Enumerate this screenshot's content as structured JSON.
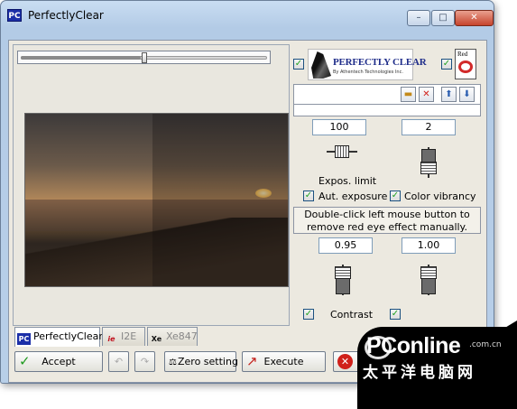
{
  "window": {
    "title": "PerfectlyClear",
    "icon_text": "PC",
    "controls": {
      "minimize": "–",
      "maximize": "□",
      "close": "✕"
    }
  },
  "logo": {
    "name": "PERFECTLY CLEAR",
    "sub": "By Athentech Technologies Inc."
  },
  "redeye_badge": "Red",
  "toolbar_icons": [
    "open-folder-icon",
    "delete-x-icon",
    "arrow-up-icon",
    "arrow-down-icon"
  ],
  "controls": {
    "exposure_value": "100",
    "vibrancy_value": "2",
    "expos_limit_label": "Expos. limit",
    "aut_exposure_label": "Aut. exposure",
    "color_vibrancy_label": "Color vibrancy",
    "aut_exposure_checked": true,
    "color_vibrancy_checked": true,
    "redeye_note": "Double-click left mouse button to remove red eye effect manually.",
    "contrast_value": "0.95",
    "gamma_value": "1.00",
    "contrast_label": "Contrast",
    "contrast_checked": true,
    "second_checked": true
  },
  "tabs": [
    {
      "label": "PerfectlyClear",
      "icon": "PC",
      "active": true
    },
    {
      "label": "I2E",
      "icon": "ie",
      "active": false
    },
    {
      "label": "Xe847",
      "icon": "Xe",
      "active": false
    }
  ],
  "buttons": {
    "accept": "Accept",
    "zero_setting": "Zero setting",
    "execute": "Execute"
  },
  "watermark": {
    "brand": "PConline",
    "domain": ".com.cn",
    "chinese": "太平洋电脑网"
  }
}
